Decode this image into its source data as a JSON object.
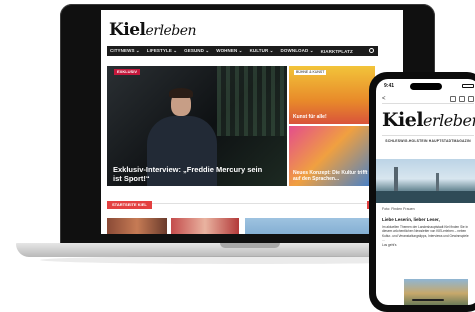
{
  "laptop": {
    "brand": {
      "name": "Kiel",
      "suffix": "erleben"
    },
    "nav": [
      "CITYNEWS ⌄",
      "LIFESTYLE ⌄",
      "GESUND ⌄",
      "WOHNEN ⌄",
      "KULTUR ⌄",
      "DOWNLOAD ⌄",
      "KIARKTPLATZ"
    ],
    "hero": {
      "tag": "EXKLUSIV",
      "title": "Exklusiv-Interview: „Freddie Mercury sein ist Sport!“"
    },
    "side_cards": [
      {
        "tag": "BÜHNE & KUNST",
        "title": "Kunst für alle!"
      },
      {
        "tag": "",
        "title": "Neues Konzept: Die Kultur trifft auf den Sprachen..."
      }
    ],
    "section_label": "STARTSEITE KIEL"
  },
  "phone": {
    "time": "9:41",
    "back": "<",
    "brand": {
      "name": "Kiel",
      "suffix": "erleben"
    },
    "tagline": "SCHLESWIG-HOLSTEIN HAUPTSTADTMAGAZIN",
    "caption": "Foto: Finden Frauen",
    "greeting": "Liebe Leserin, lieber Leser,",
    "body": "Im aktuellen Themen der Landeshauptstadt Kiel finden Sie in diesem wöchentlichen Newsletter von KIELerleben – neben Kultur- und Veranstaltungstipps, Interviews und Gewinnspiele ...",
    "signoff": "Los geht's"
  }
}
